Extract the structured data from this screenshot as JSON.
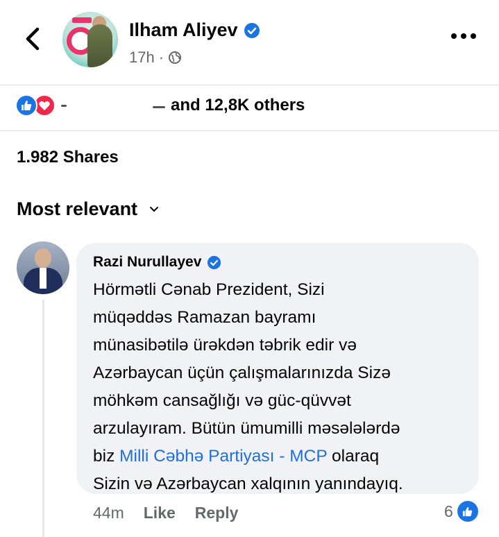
{
  "post": {
    "author": "Ilham Aliyev",
    "time": "17h",
    "separator": "·",
    "reactions_text": "and 12,8K others",
    "shares": "1.982 Shares"
  },
  "comments_sort": {
    "label": "Most relevant"
  },
  "comment": {
    "author": "Razi Nurullayev",
    "lines": [
      "Hörmətli Cənab Prezident, Sizi",
      "müqəddəs Ramazan bayramı",
      "münasibətilə ürəkdən təbrik edir və",
      "Azərbaycan üçün çalışmalarınızda Sizə",
      "möhkəm cansağlığı və güc-qüvvət",
      "arzulayıram. Bütün ümumilli məsələlərdə"
    ],
    "line7_before": "biz",
    "link_text": "Milli Cəbhə Partiyası - MCP",
    "line7_after": "olaraq",
    "line8": "Sizin və Azərbaycan xalqının yanındayıq.",
    "time": "44m",
    "like_label": "Like",
    "reply_label": "Reply",
    "reaction_count": "6"
  },
  "colors": {
    "like_blue": "#1b74e4",
    "love_red": "#f0284a",
    "link_blue": "#216fdb",
    "secondary_text": "#65676b",
    "bubble_bg": "#f0f2f5"
  }
}
